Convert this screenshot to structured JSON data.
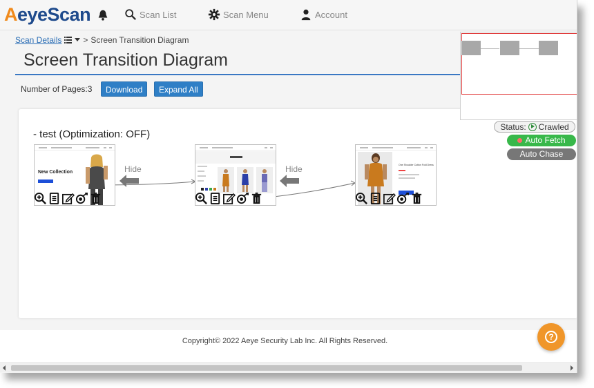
{
  "app": {
    "logo_first": "A",
    "logo_rest": "eyeScan"
  },
  "nav": {
    "scan_list": "Scan List",
    "scan_menu": "Scan Menu",
    "account": "Account"
  },
  "breadcrumb": {
    "link": "Scan Details",
    "separator": ">",
    "current": "Screen Transition Diagram"
  },
  "page": {
    "title": "Screen Transition Diagram",
    "pages_count": "Number of Pages:3",
    "download_label": "Download",
    "expand_all_label": "Expand All"
  },
  "diagram": {
    "test_title": "- test (Optimization: OFF)",
    "hide_label_1": "Hide",
    "hide_label_2": "Hide",
    "page1_text": "New Collection",
    "page3_text": "One Shoulder Cotton Fold Dress"
  },
  "status": {
    "label": "Status:",
    "value": "Crawled",
    "auto_fetch": "Auto Fetch",
    "auto_chase": "Auto Chase"
  },
  "footer": {
    "copyright": "Copyright© 2022 Aeye Security Lab Inc. All Rights Reserved."
  },
  "colors": {
    "brand_orange": "#f08a1c",
    "brand_blue": "#1e4a8c",
    "accent": "#2f7fc6",
    "auto_fetch_green": "#38b84a",
    "minimap_viewport_red": "#e03a3a"
  }
}
